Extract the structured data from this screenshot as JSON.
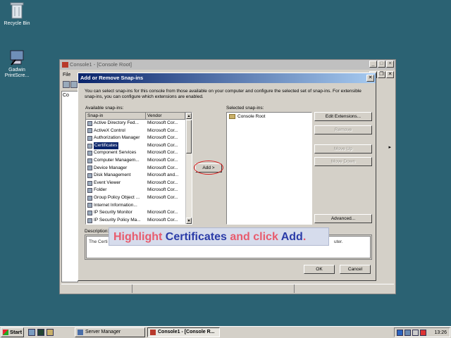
{
  "desktop": {
    "recycle_bin": "Recycle Bin",
    "gadwin": "Gadwin PrintScre..."
  },
  "mmc": {
    "title": "Console1 - [Console Root]",
    "menu_first": "File",
    "tree_first": "Co"
  },
  "dialog": {
    "title": "Add or Remove Snap-ins",
    "close": "✕",
    "intro": "You can select snap-ins for this console from those available on your computer and configure the selected set of snap-ins. For extensible snap-ins, you can configure which extensions are enabled.",
    "available_label": "Available snap-ins:",
    "selected_label": "Selected snap-ins:",
    "columns": {
      "snapin": "Snap-in",
      "vendor": "Vendor"
    },
    "available": [
      {
        "name": "Active Directory Fed...",
        "vendor": "Microsoft Cor..."
      },
      {
        "name": "ActiveX Control",
        "vendor": "Microsoft Cor..."
      },
      {
        "name": "Authorization Manager",
        "vendor": "Microsoft Cor..."
      },
      {
        "name": "Certificates",
        "vendor": "Microsoft Cor..."
      },
      {
        "name": "Component Services",
        "vendor": "Microsoft Cor..."
      },
      {
        "name": "Computer Managem...",
        "vendor": "Microsoft Cor..."
      },
      {
        "name": "Device Manager",
        "vendor": "Microsoft Cor..."
      },
      {
        "name": "Disk Management",
        "vendor": "Microsoft and..."
      },
      {
        "name": "Event Viewer",
        "vendor": "Microsoft Cor..."
      },
      {
        "name": "Folder",
        "vendor": "Microsoft Cor..."
      },
      {
        "name": "Group Policy Object ...",
        "vendor": "Microsoft Cor..."
      },
      {
        "name": "Internet Information...",
        "vendor": ""
      },
      {
        "name": "IP Security Monitor",
        "vendor": "Microsoft Cor..."
      },
      {
        "name": "IP Security Policy Ma...",
        "vendor": "Microsoft Cor..."
      }
    ],
    "selected": [
      "Console Root"
    ],
    "buttons": {
      "edit": "Edit Extensions...",
      "remove": "Remove",
      "move_up": "Move Up",
      "move_down": "Move Down",
      "add": "Add >",
      "advanced": "Advanced...",
      "ok": "OK",
      "cancel": "Cancel"
    },
    "description_label": "Description:",
    "description_start": "The Certi",
    "description_end": "uter."
  },
  "callout": {
    "w1": "Highlight",
    "w2": "Certificates",
    "w3": "and click",
    "w4": "Add",
    "w5": "."
  },
  "taskbar": {
    "start": "Start",
    "tasks": [
      "Server Manager",
      "Console1 - [Console R..."
    ],
    "clock": "13:26"
  }
}
